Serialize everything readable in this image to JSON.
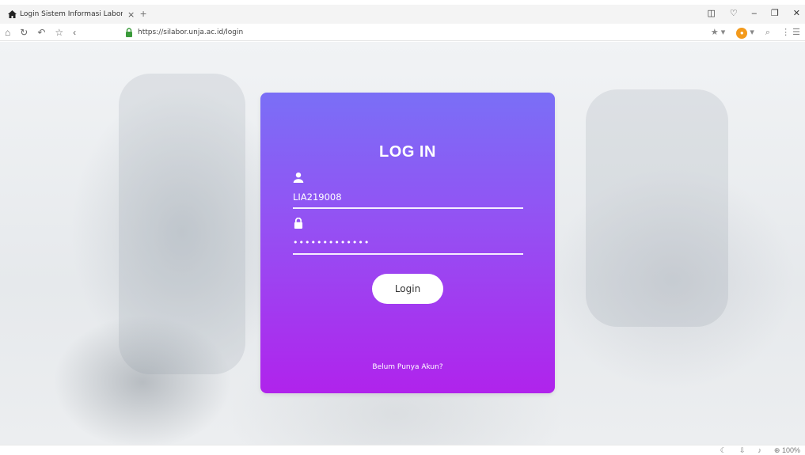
{
  "browser": {
    "tab_title": "Login Sistem Informasi Labor",
    "tab_close": "×",
    "new_tab": "+",
    "url_scheme_host": "https://silabor.unja.ac.id/login",
    "zoom": "100%"
  },
  "login": {
    "title": "LOG IN",
    "username_value": "LIA219008",
    "password_mask": "•••••••••••••",
    "button_label": "Login",
    "signup_link": "Belum Punya Akun?"
  },
  "colors": {
    "card_top": "#7a6ff6",
    "card_bottom": "#b023ec",
    "button_bg": "#ffffff"
  }
}
